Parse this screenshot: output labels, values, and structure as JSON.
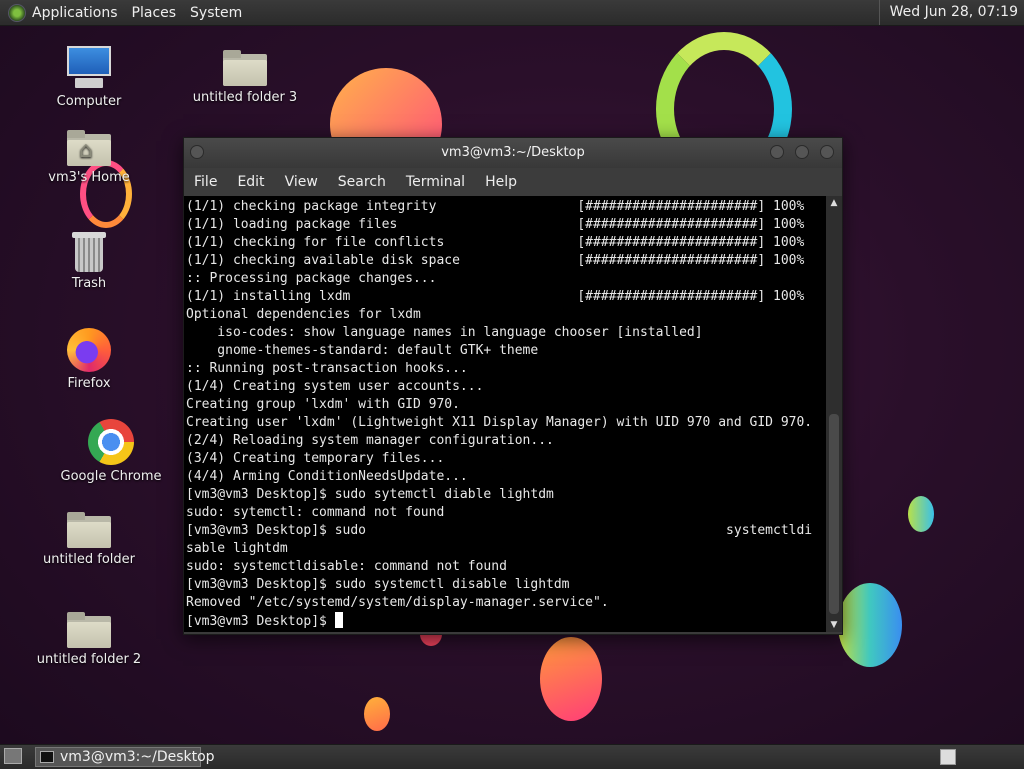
{
  "top_panel": {
    "menus": [
      "Applications",
      "Places",
      "System"
    ],
    "clock": "Wed Jun 28, 07:19"
  },
  "desktop_icons": {
    "computer": "Computer",
    "home": "vm3's Home",
    "trash": "Trash",
    "firefox": "Firefox",
    "chrome": "Google Chrome",
    "folder1": "untitled folder",
    "folder2": "untitled folder 2",
    "folder3": "untitled folder 3"
  },
  "terminal": {
    "title": "vm3@vm3:~/Desktop",
    "menu": [
      "File",
      "Edit",
      "View",
      "Search",
      "Terminal",
      "Help"
    ],
    "lines": [
      "(1/1) checking package integrity                  [######################] 100%",
      "(1/1) loading package files                       [######################] 100%",
      "(1/1) checking for file conflicts                 [######################] 100%",
      "(1/1) checking available disk space               [######################] 100%",
      ":: Processing package changes...",
      "(1/1) installing lxdm                             [######################] 100%",
      "Optional dependencies for lxdm",
      "    iso-codes: show language names in language chooser [installed]",
      "    gnome-themes-standard: default GTK+ theme",
      ":: Running post-transaction hooks...",
      "(1/4) Creating system user accounts...",
      "Creating group 'lxdm' with GID 970.",
      "Creating user 'lxdm' (Lightweight X11 Display Manager) with UID 970 and GID 970.",
      "(2/4) Reloading system manager configuration...",
      "(3/4) Creating temporary files...",
      "(4/4) Arming ConditionNeedsUpdate...",
      "[vm3@vm3 Desktop]$ sudo sytemctl diable lightdm",
      "sudo: sytemctl: command not found",
      "[vm3@vm3 Desktop]$ sudo                                              systemctldi",
      "sable lightdm",
      "sudo: systemctldisable: command not found",
      "[vm3@vm3 Desktop]$ sudo systemctl disable lightdm",
      "Removed \"/etc/systemd/system/display-manager.service\".",
      "[vm3@vm3 Desktop]$ "
    ]
  },
  "bottom_panel": {
    "task_label": "vm3@vm3:~/Desktop"
  }
}
